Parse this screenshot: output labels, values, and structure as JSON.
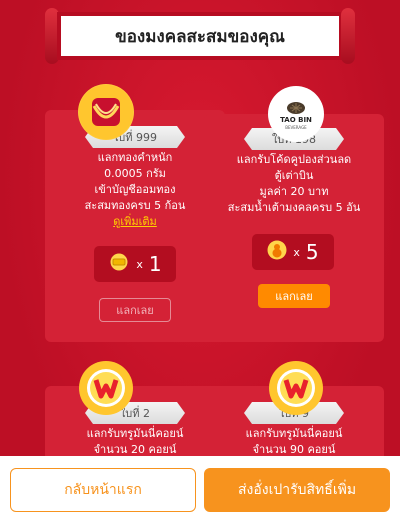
{
  "header": {
    "title": "ของมงคลสะสมของคุณ"
  },
  "cards": [
    {
      "ribbon": "ใบที่ 999",
      "lines": [
        "แลกทองคำหนัก",
        "0.0005 กรัม",
        "เข้าบัญชีออมทอง",
        "สะสมทองครบ 5 ก้อน"
      ],
      "more_link": "ดูเพิ่มเติม",
      "qty_x": "x",
      "qty": "1",
      "button": "แลกเลย",
      "button_state": "disabled",
      "icon": "gold-necklace-icon"
    },
    {
      "ribbon": "ใบที่ 198",
      "brand_top": "TAO BIN",
      "brand_sub": "BEVERAGE",
      "lines": [
        "แลกรับโค้ดคูปองส่วนลด",
        "ตู้เต่าบิน",
        "มูลค่า 20 บาท",
        "สะสมน้ำเต้ามงคลครบ 5 อัน"
      ],
      "qty_x": "x",
      "qty": "5",
      "button": "แลกเลย",
      "button_state": "active",
      "icon": "taobin-logo-icon"
    },
    {
      "ribbon": "ใบที่ 2",
      "lines": [
        "แลกรับทรูมันนี่คอยน์",
        "จำนวน 20 คอยน์"
      ],
      "icon": "truemoney-coin-icon"
    },
    {
      "ribbon": "ใบที่ 9",
      "lines": [
        "แลกรับทรูมันนี่คอยน์",
        "จำนวน 90 คอยน์"
      ],
      "icon": "truemoney-coin-icon"
    }
  ],
  "bottom": {
    "back_label": "กลับหน้าแรก",
    "send_label": "ส่งอั่งเปารับสิทธิ์เพิ่ม"
  },
  "colors": {
    "background": "#c8102e",
    "card": "#d42236",
    "accent": "#f7931e",
    "link": "#ffd000"
  }
}
